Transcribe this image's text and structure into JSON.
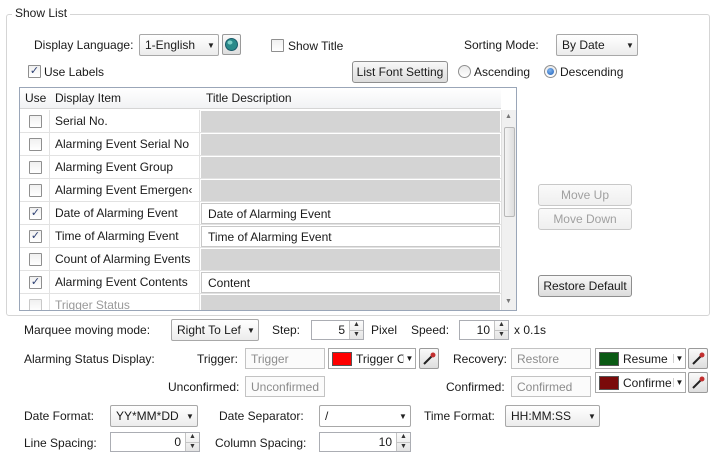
{
  "group": {
    "title": "Show List"
  },
  "display_language": {
    "label": "Display Language:",
    "value": "1-English"
  },
  "show_title": {
    "label": "Show Title",
    "checked": false
  },
  "sorting_mode": {
    "label": "Sorting Mode:",
    "value": "By Date"
  },
  "use_labels": {
    "label": "Use Labels",
    "checked": true
  },
  "list_font_setting": {
    "label": "List Font Setting"
  },
  "ascending": {
    "label": "Ascending",
    "selected": false
  },
  "descending": {
    "label": "Descending",
    "selected": true
  },
  "table": {
    "columns": [
      "Use",
      "Display Item",
      "Title Description"
    ],
    "rows": [
      {
        "use": false,
        "item": "Serial No.",
        "desc": ""
      },
      {
        "use": false,
        "item": "Alarming Event Serial No",
        "desc": ""
      },
      {
        "use": false,
        "item": "Alarming Event Group",
        "desc": ""
      },
      {
        "use": false,
        "item": "Alarming Event Emergen‹",
        "desc": ""
      },
      {
        "use": true,
        "item": "Date of Alarming Event",
        "desc": "Date of Alarming Event"
      },
      {
        "use": true,
        "item": "Time of Alarming Event",
        "desc": "Time of Alarming Event"
      },
      {
        "use": false,
        "item": "Count of Alarming Events",
        "desc": ""
      },
      {
        "use": true,
        "item": "Alarming Event Contents",
        "desc": "Content"
      },
      {
        "use": false,
        "item": "Trigger Status",
        "desc": ""
      }
    ]
  },
  "move_up": {
    "label": "Move Up"
  },
  "move_down": {
    "label": "Move Down"
  },
  "restore_default": {
    "label": "Restore Default"
  },
  "marquee": {
    "label": "Marquee moving mode:",
    "value": "Right To Lef"
  },
  "step": {
    "label": "Step:",
    "value": "5",
    "unit": "Pixel"
  },
  "speed": {
    "label": "Speed:",
    "value": "10",
    "unit": "x 0.1s"
  },
  "alarm_status": {
    "label": "Alarming Status Display:",
    "trigger": {
      "label": "Trigger:",
      "placeholder": "Trigger",
      "color_name": "Trigger C",
      "color": "#ff0000"
    },
    "recovery": {
      "label": "Recovery:",
      "placeholder": "Restore",
      "color_name": "Resume",
      "color": "#0a5a14"
    },
    "unconfirmed": {
      "label": "Unconfirmed:",
      "placeholder": "Unconfirmed"
    },
    "confirmed": {
      "label": "Confirmed:",
      "placeholder": "Confirmed",
      "color_name": "Confirme",
      "color": "#7a0a0a"
    }
  },
  "date_format": {
    "label": "Date Format:",
    "value": "YY*MM*DD"
  },
  "date_separator": {
    "label": "Date Separator:",
    "value": "/"
  },
  "time_format": {
    "label": "Time Format:",
    "value": "HH:MM:SS"
  },
  "line_spacing": {
    "label": "Line Spacing:",
    "value": "0"
  },
  "column_spacing": {
    "label": "Column Spacing:",
    "value": "10"
  },
  "icons": {
    "language": "globe-icon",
    "dropdown": "chevron-down-icon",
    "spin": "spin-arrows-icon",
    "picker": "eyedropper-icon",
    "check": "checkmark-icon"
  }
}
